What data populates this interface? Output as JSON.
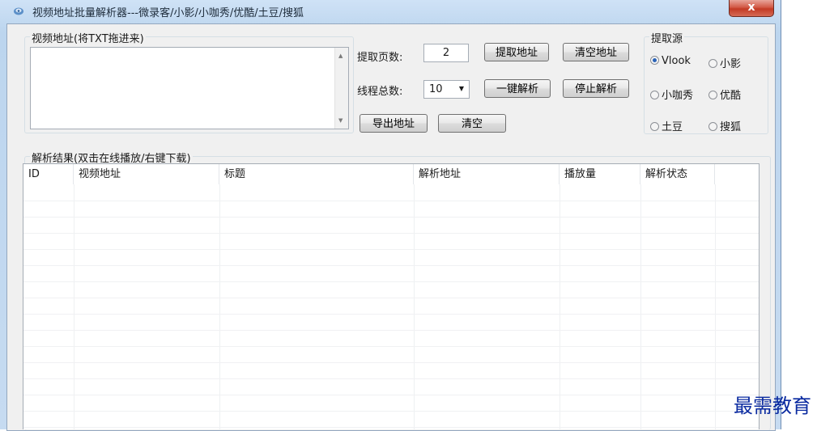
{
  "window": {
    "title": "视频地址批量解析器---微录客/小影/小咖秀/优酷/土豆/搜狐",
    "close_label": "x"
  },
  "input_group": {
    "label": "视频地址(将TXT拖进来)",
    "textarea_value": ""
  },
  "controls": {
    "pages_label": "提取页数:",
    "pages_value": "2",
    "threads_label": "线程总数:",
    "threads_value": "10",
    "extract_button": "提取地址",
    "clear_address_button": "清空地址",
    "parse_all_button": "一键解析",
    "stop_parse_button": "停止解析",
    "export_button": "导出地址",
    "clear_button": "清空"
  },
  "source_group": {
    "label": "提取源",
    "options": [
      {
        "label": "Vlook",
        "selected": true
      },
      {
        "label": "小影",
        "selected": false
      },
      {
        "label": "小咖秀",
        "selected": false
      },
      {
        "label": "优酷",
        "selected": false
      },
      {
        "label": "土豆",
        "selected": false
      },
      {
        "label": "搜狐",
        "selected": false
      }
    ]
  },
  "results": {
    "label": "解析结果(双击在线播放/右键下载)",
    "columns": [
      "ID",
      "视频地址",
      "标题",
      "解析地址",
      "播放量",
      "解析状态"
    ],
    "rows": []
  },
  "watermark": "最需教育"
}
